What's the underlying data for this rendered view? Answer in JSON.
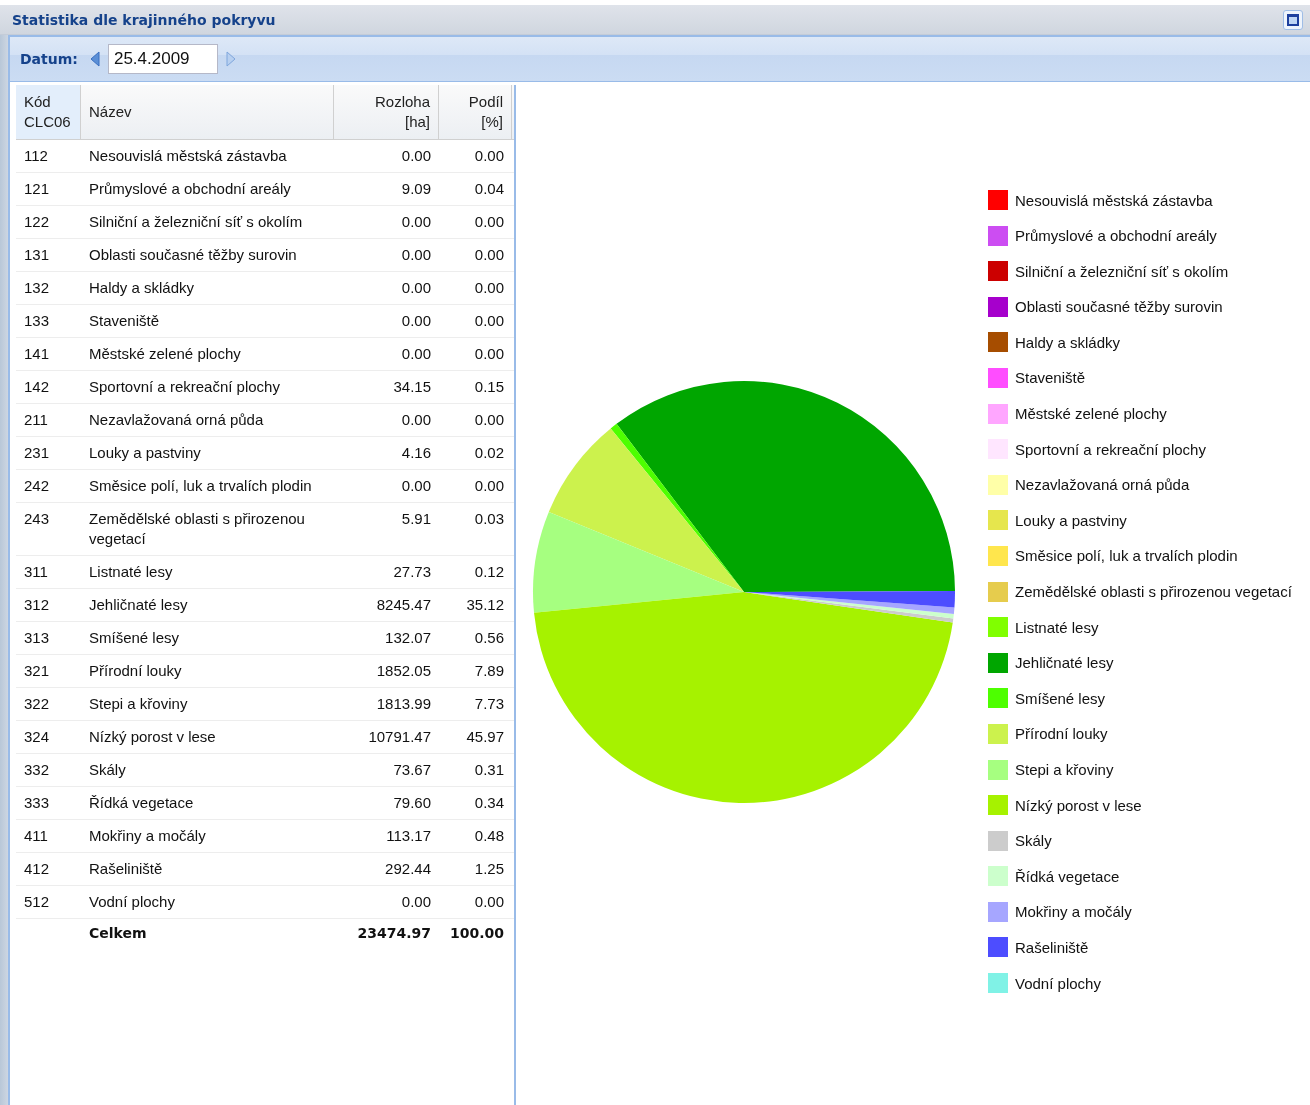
{
  "panel": {
    "title": "Statistika dle krajinného pokryvu"
  },
  "toolbar": {
    "label": "Datum:",
    "date": "25.4.2009"
  },
  "table": {
    "columns": [
      "Kód CLC06",
      "Název",
      "Rozloha [ha]",
      "Podíl [%]"
    ],
    "rows": [
      {
        "code": "112",
        "name": "Nesouvislá městská zástavba",
        "area": "0.00",
        "share": "0.00"
      },
      {
        "code": "121",
        "name": "Průmyslové a obchodní areály",
        "area": "9.09",
        "share": "0.04"
      },
      {
        "code": "122",
        "name": "Silniční a železniční síť s okolím",
        "area": "0.00",
        "share": "0.00"
      },
      {
        "code": "131",
        "name": "Oblasti současné těžby surovin",
        "area": "0.00",
        "share": "0.00"
      },
      {
        "code": "132",
        "name": "Haldy a skládky",
        "area": "0.00",
        "share": "0.00"
      },
      {
        "code": "133",
        "name": "Staveniště",
        "area": "0.00",
        "share": "0.00"
      },
      {
        "code": "141",
        "name": "Městské zelené plochy",
        "area": "0.00",
        "share": "0.00"
      },
      {
        "code": "142",
        "name": "Sportovní a rekreační plochy",
        "area": "34.15",
        "share": "0.15"
      },
      {
        "code": "211",
        "name": "Nezavlažovaná orná půda",
        "area": "0.00",
        "share": "0.00"
      },
      {
        "code": "231",
        "name": "Louky a pastviny",
        "area": "4.16",
        "share": "0.02"
      },
      {
        "code": "242",
        "name": "Směsice polí, luk a trvalích plodin",
        "area": "0.00",
        "share": "0.00"
      },
      {
        "code": "243",
        "name": "Zemědělské oblasti s přirozenou vegetací",
        "area": "5.91",
        "share": "0.03"
      },
      {
        "code": "311",
        "name": "Listnaté lesy",
        "area": "27.73",
        "share": "0.12"
      },
      {
        "code": "312",
        "name": "Jehličnaté lesy",
        "area": "8245.47",
        "share": "35.12"
      },
      {
        "code": "313",
        "name": "Smíšené lesy",
        "area": "132.07",
        "share": "0.56"
      },
      {
        "code": "321",
        "name": "Přírodní louky",
        "area": "1852.05",
        "share": "7.89"
      },
      {
        "code": "322",
        "name": "Stepi a křoviny",
        "area": "1813.99",
        "share": "7.73"
      },
      {
        "code": "324",
        "name": "Nízký porost v lese",
        "area": "10791.47",
        "share": "45.97"
      },
      {
        "code": "332",
        "name": "Skály",
        "area": "73.67",
        "share": "0.31"
      },
      {
        "code": "333",
        "name": "Řídká vegetace",
        "area": "79.60",
        "share": "0.34"
      },
      {
        "code": "411",
        "name": "Mokřiny a močály",
        "area": "113.17",
        "share": "0.48"
      },
      {
        "code": "412",
        "name": "Rašeliniště",
        "area": "292.44",
        "share": "1.25"
      },
      {
        "code": "512",
        "name": "Vodní plochy",
        "area": "0.00",
        "share": "0.00"
      }
    ],
    "total": {
      "label": "Celkem",
      "area": "23474.97",
      "share": "100.00"
    }
  },
  "chart_data": {
    "type": "pie",
    "legend": "right",
    "categories": [
      "Nesouvislá městská zástavba",
      "Průmyslové a obchodní areály",
      "Silniční a železniční síť s okolím",
      "Oblasti současné těžby surovin",
      "Haldy a skládky",
      "Staveniště",
      "Městské zelené plochy",
      "Sportovní a rekreační plochy",
      "Nezavlažovaná orná půda",
      "Louky a pastviny",
      "Směsice polí, luk a trvalích plodin",
      "Zemědělské oblasti s přirozenou vegetací",
      "Listnaté lesy",
      "Jehličnaté lesy",
      "Smíšené lesy",
      "Přírodní louky",
      "Stepi a křoviny",
      "Nízký porost v lese",
      "Skály",
      "Řídká vegetace",
      "Mokřiny a močály",
      "Rašeliniště",
      "Vodní plochy"
    ],
    "values": [
      0,
      null,
      0,
      0,
      0,
      0,
      0,
      null,
      0,
      null,
      0,
      null,
      null,
      35.12,
      0.56,
      7.89,
      7.73,
      45.97,
      0.31,
      0.34,
      0.48,
      1.25,
      0
    ],
    "colors": [
      "#ff0000",
      "#cc4df2",
      "#cc0000",
      "#a600cc",
      "#a64d00",
      "#ff4dff",
      "#ffa6ff",
      "#ffe6ff",
      "#ffffa8",
      "#e6e64d",
      "#ffe64d",
      "#e6cc4d",
      "#80ff00",
      "#00a600",
      "#4dff00",
      "#ccf24d",
      "#a6ff80",
      "#a6f200",
      "#cccccc",
      "#ccffcc",
      "#a6a6ff",
      "#4d4dff",
      "#80f2e6"
    ]
  }
}
